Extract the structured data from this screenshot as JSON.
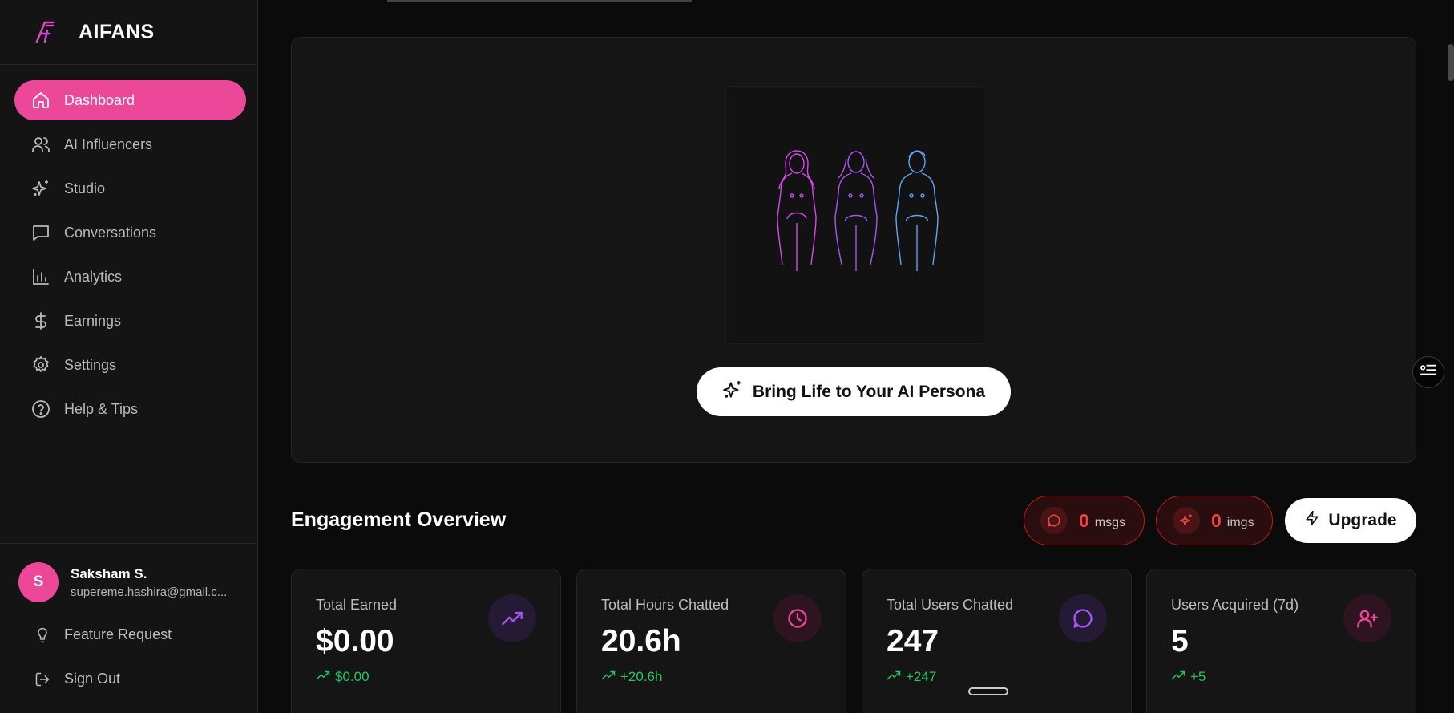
{
  "app": {
    "brand": "AIFANS",
    "accent_color": "#ec4899",
    "background_color": "#0b0b0b"
  },
  "sidebar": {
    "items": [
      {
        "label": "Dashboard",
        "icon": "home-icon",
        "active": true
      },
      {
        "label": "AI Influencers",
        "icon": "users-icon",
        "active": false
      },
      {
        "label": "Studio",
        "icon": "sparkles-icon",
        "active": false
      },
      {
        "label": "Conversations",
        "icon": "chat-icon",
        "active": false
      },
      {
        "label": "Analytics",
        "icon": "bar-chart-icon",
        "active": false
      },
      {
        "label": "Earnings",
        "icon": "dollar-icon",
        "active": false
      },
      {
        "label": "Settings",
        "icon": "gear-icon",
        "active": false
      },
      {
        "label": "Help & Tips",
        "icon": "help-circle-icon",
        "active": false
      }
    ],
    "user": {
      "initial": "S",
      "name": "Saksham S.",
      "email": "supereme.hashira@gmail.c..."
    },
    "feature_request": "Feature Request",
    "sign_out": "Sign Out"
  },
  "hero": {
    "cta_label": "Bring Life to Your AI Persona",
    "cta_icon": "sparkles-icon",
    "image_icon": "three-figures-illustration"
  },
  "engagement": {
    "title": "Engagement Overview",
    "msgs": {
      "count": "0",
      "unit": "msgs",
      "icon": "chat-icon"
    },
    "imgs": {
      "count": "0",
      "unit": "imgs",
      "icon": "sparkles-icon"
    },
    "upgrade_label": "Upgrade",
    "upgrade_icon": "lightning-icon",
    "cards": [
      {
        "label": "Total Earned",
        "value": "$0.00",
        "trend": "$0.00",
        "icon": "trending-up-icon",
        "icon_color": "#a855f7"
      },
      {
        "label": "Total Hours Chatted",
        "value": "20.6h",
        "trend": "+20.6h",
        "icon": "clock-icon",
        "icon_color": "#ec4899"
      },
      {
        "label": "Total Users Chatted",
        "value": "247",
        "trend": "+247",
        "icon": "chat-icon",
        "icon_color": "#a855f7"
      },
      {
        "label": "Users Acquired (7d)",
        "value": "5",
        "trend": "+5",
        "icon": "user-plus-icon",
        "icon_color": "#ec4899"
      }
    ]
  }
}
